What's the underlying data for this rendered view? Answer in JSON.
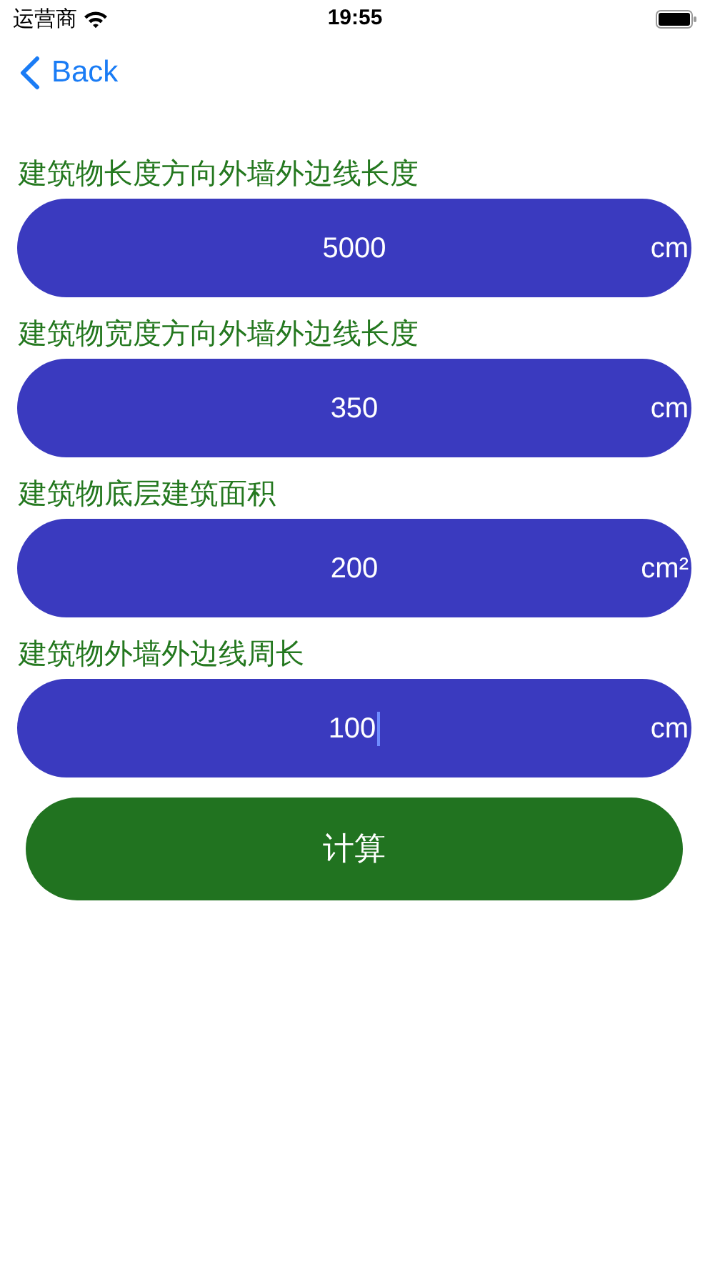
{
  "status_bar": {
    "carrier": "运营商",
    "time": "19:55"
  },
  "nav": {
    "back": "Back"
  },
  "fields": [
    {
      "label": "建筑物长度方向外墙外边线长度",
      "value": "5000",
      "unit": "cm",
      "focused": false
    },
    {
      "label": "建筑物宽度方向外墙外边线长度",
      "value": "350",
      "unit": "cm",
      "focused": false
    },
    {
      "label": "建筑物底层建筑面积",
      "value": "200",
      "unit": "cm²",
      "focused": false
    },
    {
      "label": "建筑物外墙外边线周长",
      "value": "100",
      "unit": "cm",
      "focused": true
    }
  ],
  "button": "计算"
}
